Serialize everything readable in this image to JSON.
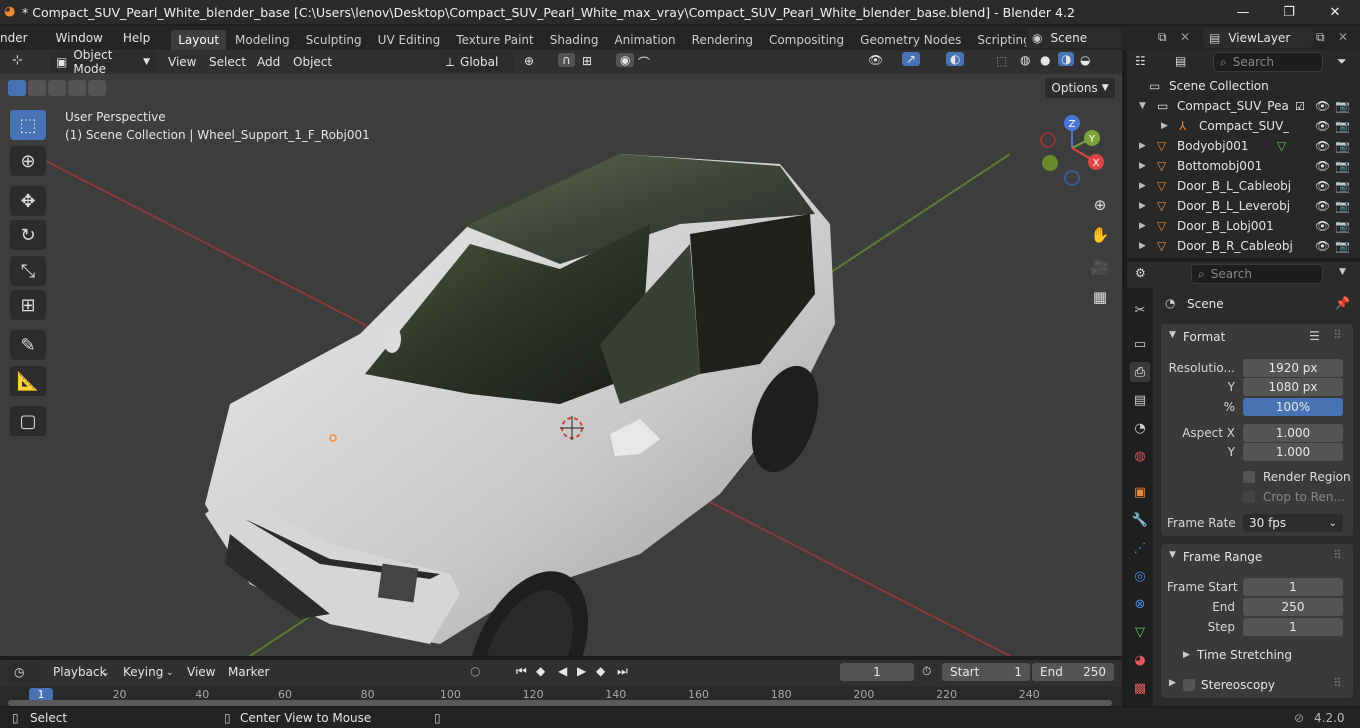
{
  "window": {
    "title": "* Compact_SUV_Pearl_White_blender_base [C:\\Users\\lenov\\Desktop\\Compact_SUV_Pearl_White_max_vray\\Compact_SUV_Pearl_White_blender_base.blend] - Blender 4.2",
    "minimize": "—",
    "maximize": "❐",
    "close": "✕"
  },
  "menu": {
    "items": [
      "nder",
      "Window",
      "Help"
    ],
    "workspaces": [
      "Layout",
      "Modeling",
      "Sculpting",
      "UV Editing",
      "Texture Paint",
      "Shading",
      "Animation",
      "Rendering",
      "Compositing",
      "Geometry Nodes",
      "Scripting"
    ],
    "active_workspace": "Layout",
    "add_tab": "+",
    "scene_name": "Scene",
    "view_layer": "ViewLayer"
  },
  "viewport_header": {
    "mode": "Object Mode",
    "menus": [
      "View",
      "Select",
      "Add",
      "Object"
    ],
    "orientation": "Global",
    "options": "Options"
  },
  "viewport": {
    "perspective": "User Perspective",
    "context": "(1) Scene Collection | Wheel_Support_1_F_Robj001",
    "gizmo": {
      "x": "X",
      "y": "Y",
      "z": "Z"
    },
    "accent": "#4772b3"
  },
  "outliner": {
    "search_placeholder": "Search",
    "rows": [
      {
        "label": "Scene Collection",
        "icon": "collection-icon"
      },
      {
        "label": "Compact_SUV_Pea",
        "icon": "collection-icon"
      },
      {
        "label": "Compact_SUV_",
        "icon": "armature-icon"
      },
      {
        "label": "Bodyobj001",
        "icon": "mesh-icon"
      },
      {
        "label": "Bottomobj001",
        "icon": "mesh-icon"
      },
      {
        "label": "Door_B_L_Cableobj",
        "icon": "mesh-icon"
      },
      {
        "label": "Door_B_L_Leverobj",
        "icon": "mesh-icon"
      },
      {
        "label": "Door_B_Lobj001",
        "icon": "mesh-icon"
      },
      {
        "label": "Door_B_R_Cableobj",
        "icon": "mesh-icon"
      }
    ]
  },
  "properties": {
    "search_placeholder": "Search",
    "context": "Scene",
    "format": {
      "title": "Format",
      "resolution_label": "Resolutio...",
      "res_x": "1920 px",
      "y_label": "Y",
      "res_y": "1080 px",
      "pct_label": "%",
      "pct": "100%",
      "aspect_x_label": "Aspect X",
      "aspect_x": "1.000",
      "aspect_y_label": "Y",
      "aspect_y": "1.000",
      "render_region": "Render Region",
      "crop": "Crop to Ren...",
      "frame_rate_label": "Frame Rate",
      "frame_rate": "30 fps"
    },
    "frame_range": {
      "title": "Frame Range",
      "start_label": "Frame Start",
      "start": "1",
      "end_label": "End",
      "end": "250",
      "step_label": "Step",
      "step": "1"
    },
    "time_stretching": "Time Stretching",
    "stereoscopy": "Stereoscopy"
  },
  "timeline": {
    "menus": [
      "Playback",
      "Keying",
      "View",
      "Marker"
    ],
    "current_frame": "1",
    "start_label": "Start",
    "start": "1",
    "end_label": "End",
    "end": "250",
    "ruler": [
      "1",
      "20",
      "40",
      "60",
      "80",
      "100",
      "120",
      "140",
      "160",
      "180",
      "200",
      "220",
      "240"
    ]
  },
  "status": {
    "select": "Select",
    "center_view": "Center View to Mouse",
    "version": "4.2.0"
  }
}
